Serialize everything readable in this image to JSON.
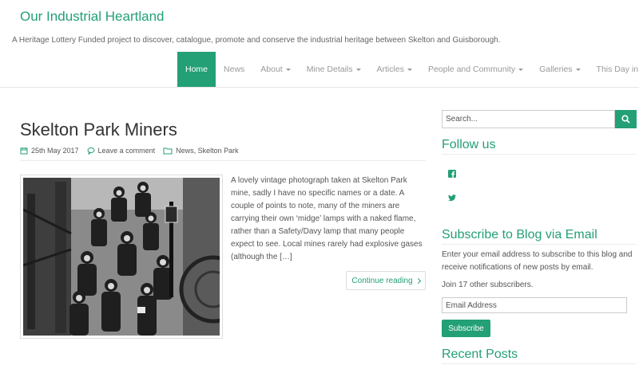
{
  "site": {
    "title": "Our Industrial Heartland",
    "description": "A Heritage Lottery Funded project to discover, catalogue, promote and conserve the industrial heritage between Skelton and Guisborough."
  },
  "nav": {
    "home": "Home",
    "news": "News",
    "about": "About",
    "mine_details": "Mine Details",
    "articles": "Articles",
    "people": "People and Community",
    "galleries": "Galleries",
    "this_day": "This Day in History"
  },
  "post": {
    "title": "Skelton Park Miners",
    "date": "25th May 2017",
    "comment": "Leave a comment",
    "categories": "News, Skelton Park",
    "excerpt": "A lovely vintage photograph taken at Skelton Park mine, sadly I have no specific names or a date. A couple of points to note, many of the miners are carrying their own ‘midge’ lamps with a naked flame, rather than a Safety/Davy lamp that many people expect to see. Local mines rarely had explosive gases (although the […]",
    "continue": "Continue reading"
  },
  "sidebar": {
    "search_placeholder": "Search...",
    "follow_title": "Follow us",
    "subscribe_title": "Subscribe to Blog via Email",
    "subscribe_text": "Enter your email address to subscribe to this blog and receive notifications of new posts by email.",
    "subscriber_count": "Join 17 other subscribers.",
    "email_placeholder": "Email Address",
    "subscribe_button": "Subscribe",
    "recent_title": "Recent Posts"
  },
  "colors": {
    "accent": "#23a075"
  },
  "icons": [
    "calendar-icon",
    "comment-icon",
    "folder-icon",
    "search-icon",
    "facebook-icon",
    "twitter-icon",
    "caret-down-icon",
    "chevron-right-icon"
  ]
}
